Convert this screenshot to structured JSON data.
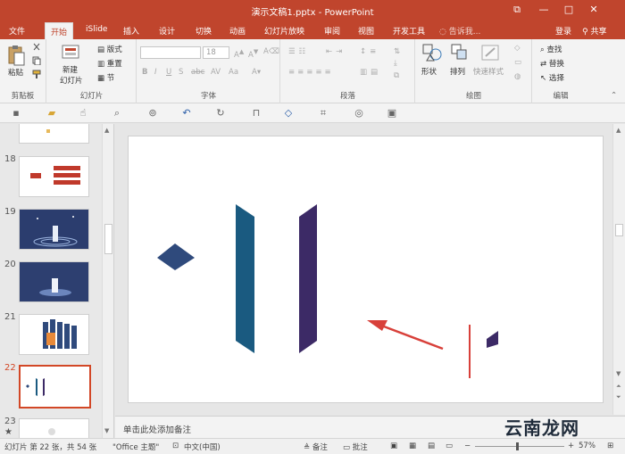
{
  "window": {
    "title": "演示文稿1.pptx - PowerPoint",
    "controls": {
      "restore": "⧉",
      "minimize": "—",
      "maximize": "□",
      "close": "✕"
    }
  },
  "tabs": [
    "文件",
    "开始",
    "iSlide",
    "插入",
    "设计",
    "切换",
    "动画",
    "幻灯片放映",
    "审阅",
    "视图",
    "开发工具"
  ],
  "tell_me": "告诉我...",
  "account": {
    "login": "登录",
    "share": "共享"
  },
  "ribbon": {
    "clipboard": {
      "paste": "粘贴",
      "label": "剪贴板"
    },
    "slides": {
      "new_slide_line1": "新建",
      "new_slide_line2": "幻灯片",
      "layout": "版式",
      "reset": "重置",
      "section": "节",
      "label": "幻灯片"
    },
    "font": {
      "size": "18",
      "label": "字体"
    },
    "paragraph": {
      "label": "段落"
    },
    "drawing": {
      "shape": "形状",
      "arrange": "排列",
      "quick_styles": "快速样式",
      "label": "绘图"
    },
    "editing": {
      "find": "查找",
      "replace": "替换",
      "select": "选择",
      "label": "编辑"
    }
  },
  "thumbnails": [
    {
      "num": "18"
    },
    {
      "num": "19"
    },
    {
      "num": "20"
    },
    {
      "num": "21"
    },
    {
      "num": "22",
      "selected": true
    },
    {
      "num": "23"
    }
  ],
  "notes_placeholder": "单击此处添加备注",
  "status": {
    "slide_info": "幻灯片 第 22 张，共 54 张",
    "theme": "\"Office 主题\"",
    "language": "中文(中国)",
    "notes": "备注",
    "comments": "批注",
    "zoom": "57%"
  },
  "watermark": "云南龙网",
  "colors": {
    "accent": "#c0452d",
    "slide_blue": "#1a5a80",
    "slide_purple": "#3c2a66",
    "arrow_red": "#d8403a"
  }
}
